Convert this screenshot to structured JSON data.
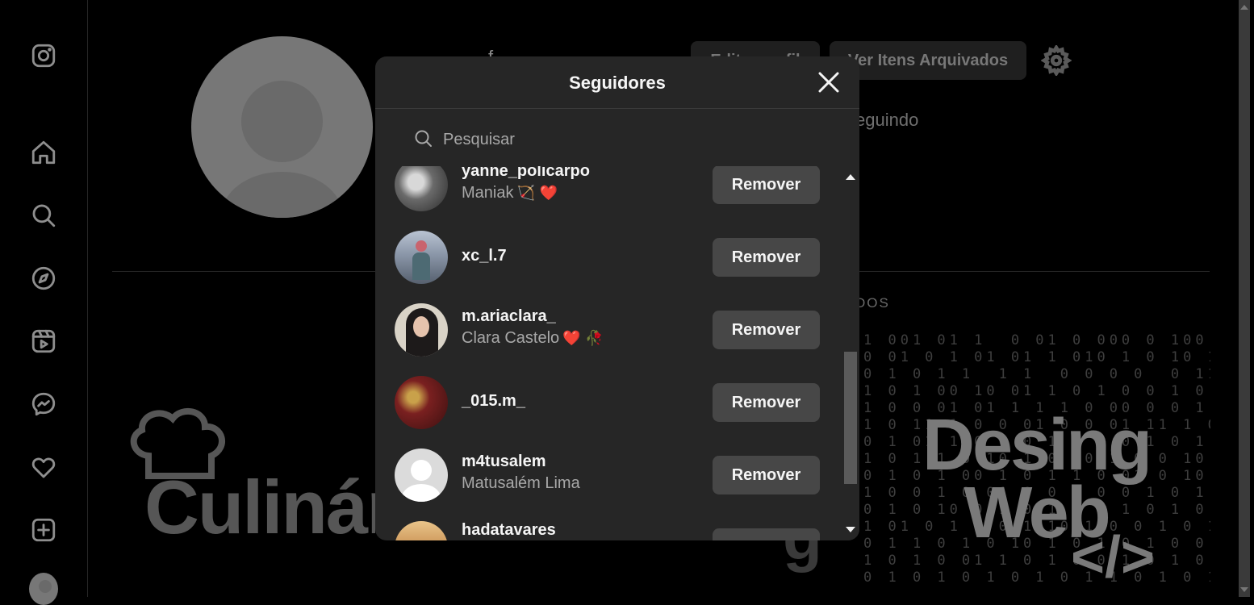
{
  "background": {
    "username": "f",
    "edit_button": "Editar perfil",
    "archived_button": "Ver Itens Arquivados",
    "following_label": "eguindo",
    "tab_label": "DOS",
    "post_left_brand": "Culinár",
    "post_right_title_line1": "Desing",
    "post_right_title_line2": "Web",
    "post_right_code": "</>",
    "post_mid_fragment": "g"
  },
  "modal": {
    "title": "Seguidores",
    "search_placeholder": "Pesquisar",
    "remove_label": "Remover",
    "followers": [
      {
        "username": "yanne_policarpo",
        "fullname": "Maniak",
        "emoji": "🏹 ❤️",
        "avatar_color": "#9a9a9a"
      },
      {
        "username": "xc_l.7",
        "fullname": "",
        "emoji": "",
        "avatar_color": "#7e8a9a"
      },
      {
        "username": "m.ariaclara_",
        "fullname": "Clara Castelo",
        "emoji": "❤️ 🥀",
        "avatar_color": "#c9c0b4"
      },
      {
        "username": "_015.m_",
        "fullname": "",
        "emoji": "",
        "avatar_color": "#6b2a2a"
      },
      {
        "username": "m4tusalem",
        "fullname": "Matusalém Lima",
        "emoji": "",
        "avatar_color": "#dcdcdc"
      },
      {
        "username": "hadatavares",
        "fullname": "",
        "emoji": "",
        "avatar_color": "#c79a5a"
      }
    ]
  },
  "nav": {
    "icons": [
      "instagram-icon",
      "home-icon",
      "search-icon",
      "explore-icon",
      "reels-icon",
      "messenger-icon",
      "heart-icon",
      "create-icon",
      "profile-avatar-icon"
    ]
  }
}
